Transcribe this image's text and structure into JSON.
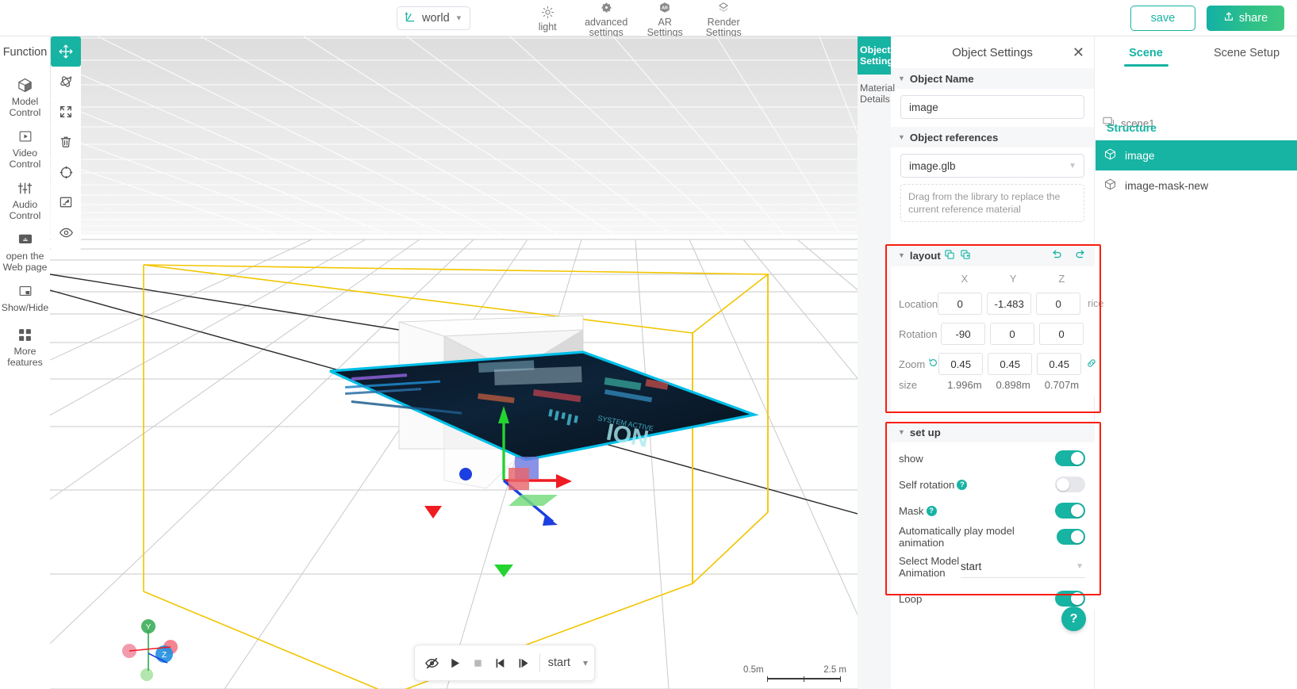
{
  "topbar": {
    "coord_mode": "world",
    "coord_icon": "axis-icon",
    "tools": [
      {
        "icon": "sun-icon",
        "label": "light"
      },
      {
        "icon": "gear-icon",
        "label": "advanced\nsettings"
      },
      {
        "icon": "ar-icon",
        "label": "AR\nSettings"
      },
      {
        "icon": "render-icon",
        "label": "Render\nSettings"
      }
    ],
    "save_label": "save",
    "share_label": "share",
    "share_icon": "upload-icon",
    "accent": "#17b3a3",
    "share_gradient_start": "#13b0a5",
    "share_gradient_end": "#3ec97f"
  },
  "left_rail": {
    "header": "Function",
    "items": [
      {
        "icon": "cube-icon",
        "label": "Model\nControl"
      },
      {
        "icon": "play-box-icon",
        "label": "Video\nControl"
      },
      {
        "icon": "sliders-icon",
        "label": "Audio\nControl"
      },
      {
        "icon": "screen-icon",
        "label": "open the\nWeb page"
      },
      {
        "icon": "pip-icon",
        "label": "Show/Hide"
      },
      {
        "icon": "grid-icon",
        "label": "More\nfeatures"
      }
    ]
  },
  "vtools": [
    {
      "icon": "move-icon",
      "active": true
    },
    {
      "icon": "rotate-icon",
      "active": false
    },
    {
      "icon": "scale-icon",
      "active": false
    },
    {
      "icon": "trash-icon",
      "active": false
    },
    {
      "icon": "target-icon",
      "active": false
    },
    {
      "icon": "fit-screen-icon",
      "active": false
    },
    {
      "icon": "eye-icon",
      "active": false
    }
  ],
  "viewport": {
    "scale_ruler": {
      "left_label": "0.5m",
      "right_label": "2.5 m"
    },
    "playbar": {
      "buttons": [
        {
          "icon": "mute-eye-icon"
        },
        {
          "icon": "play-icon"
        },
        {
          "icon": "stop-icon"
        },
        {
          "icon": "step-back-icon"
        },
        {
          "icon": "step-forward-icon"
        }
      ],
      "animation_value": "start",
      "chevron": "chevron-down-icon"
    }
  },
  "object_panel": {
    "tabs": [
      {
        "label": "Object\nSettings",
        "active": true
      },
      {
        "label": "Material\nDetails",
        "active": false
      }
    ],
    "title": "Object Settings",
    "close_icon": "close-icon",
    "object_name_section": "Object Name",
    "object_name_value": "image",
    "object_refs_section": "Object references",
    "object_ref_value": "image.glb",
    "drop_hint": "Drag from the library to replace the current reference material",
    "layout": {
      "title": "layout",
      "copy_icon": "copy-icon",
      "paste_icon": "copy-add-icon",
      "undo_icon": "undo-icon",
      "redo_icon": "redo-icon",
      "columns": [
        "X",
        "Y",
        "Z"
      ],
      "rows": [
        {
          "label": "Location",
          "values": [
            "0",
            "-1.483",
            "0"
          ],
          "unit": "rice"
        },
        {
          "label": "Rotation",
          "values": [
            "-90",
            "0",
            "0"
          ],
          "unit": ""
        },
        {
          "label": "Zoom",
          "values": [
            "0.45",
            "0.45",
            "0.45"
          ],
          "unit": "",
          "reset_icon": "reset-icon",
          "link_icon": "link-icon"
        }
      ],
      "size_label": "size",
      "size_values": [
        "1.996m",
        "0.898m",
        "0.707m"
      ]
    },
    "setup": {
      "title": "set up",
      "toggles": [
        {
          "label": "show",
          "help": false,
          "on": true
        },
        {
          "label": "Self rotation",
          "help": true,
          "on": false
        },
        {
          "label": "Mask",
          "help": true,
          "on": true
        },
        {
          "label": "Automatically play model animation",
          "help": false,
          "on": true
        }
      ],
      "animation_label": "Select Model\nAnimation",
      "animation_value": "start",
      "loop_label": "Loop",
      "loop_on": true
    },
    "highlight_color": "#fa1e0e",
    "help_fab": "?"
  },
  "scene_panel": {
    "tabs": [
      {
        "label": "Scene",
        "active": true
      },
      {
        "label": "Scene Setup",
        "active": false
      }
    ],
    "structure_label": "Structure",
    "scene_node": {
      "icon": "scene-icon",
      "label": "scene1"
    },
    "tree": [
      {
        "icon": "cube-icon",
        "label": "image",
        "selected": true
      },
      {
        "icon": "cube-icon",
        "label": "image-mask-new",
        "selected": false
      }
    ]
  }
}
